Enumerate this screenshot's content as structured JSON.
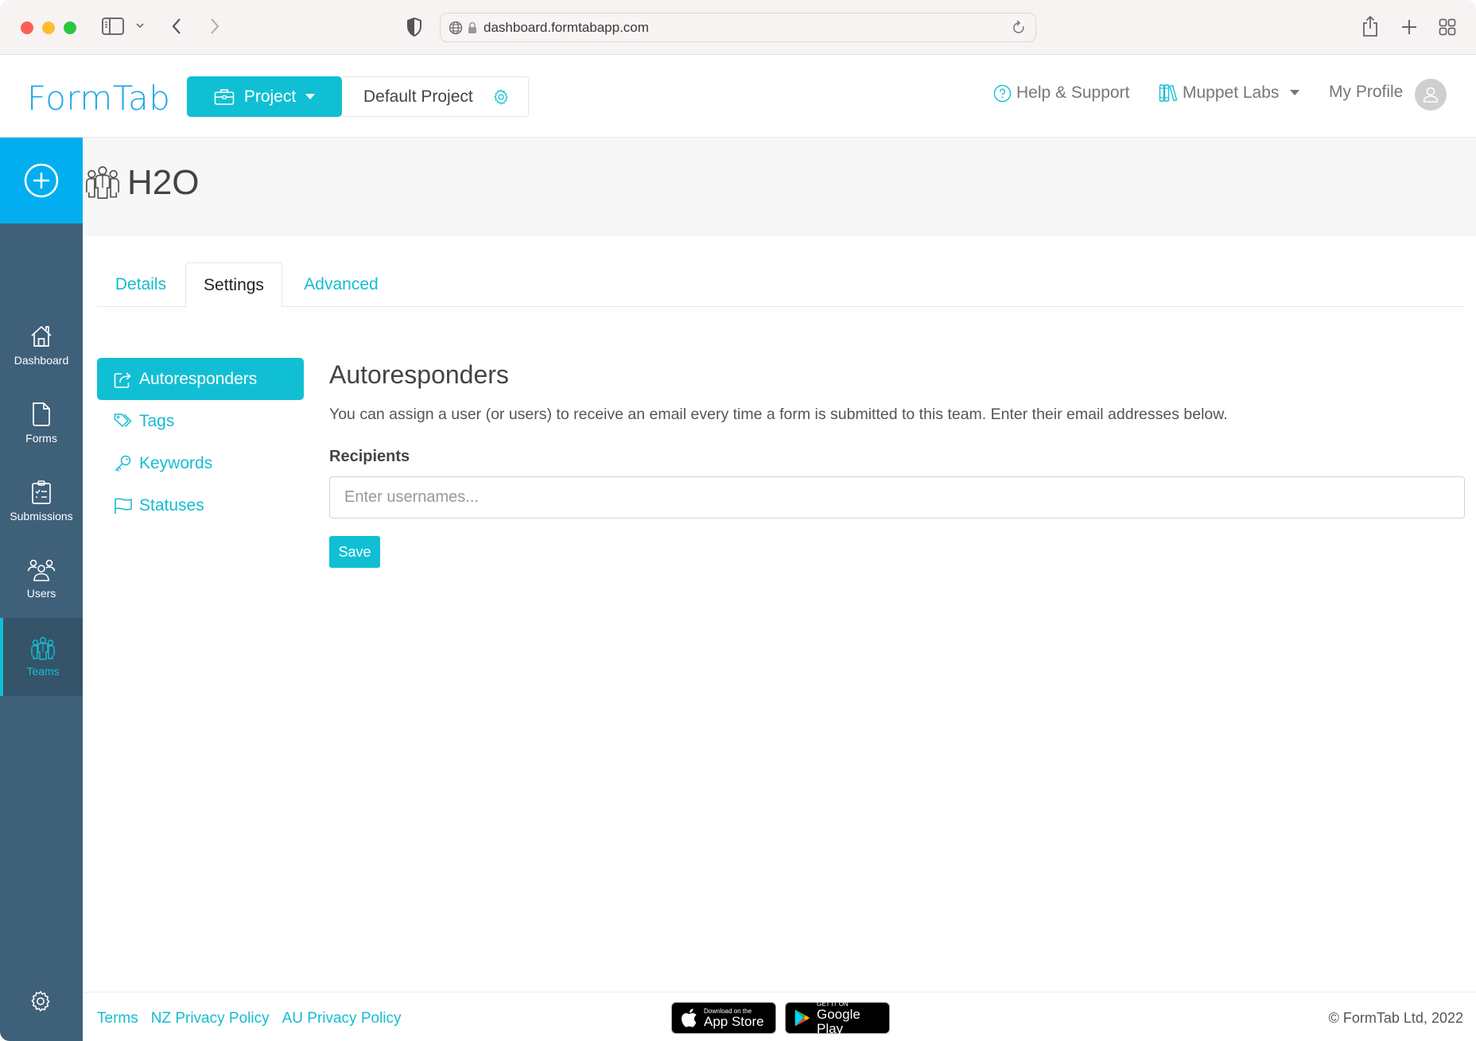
{
  "browser": {
    "url": "dashboard.formtabapp.com"
  },
  "header": {
    "logo": "FormTab",
    "project_button_label": "Project",
    "current_project": "Default Project",
    "help_label": "Help & Support",
    "org_label": "Muppet Labs",
    "profile_label": "My Profile"
  },
  "sidebar": {
    "items": [
      {
        "label": "Dashboard",
        "icon": "home-icon"
      },
      {
        "label": "Forms",
        "icon": "file-icon"
      },
      {
        "label": "Submissions",
        "icon": "clipboard-check-icon"
      },
      {
        "label": "Users",
        "icon": "users-icon"
      },
      {
        "label": "Teams",
        "icon": "team-icon",
        "active": true
      }
    ]
  },
  "page": {
    "title": "H2O"
  },
  "tabs": [
    {
      "label": "Details"
    },
    {
      "label": "Settings",
      "active": true
    },
    {
      "label": "Advanced"
    }
  ],
  "settings_nav": [
    {
      "label": "Autoresponders",
      "icon": "share-icon",
      "active": true
    },
    {
      "label": "Tags",
      "icon": "tags-icon"
    },
    {
      "label": "Keywords",
      "icon": "key-icon"
    },
    {
      "label": "Statuses",
      "icon": "flag-icon"
    }
  ],
  "content": {
    "heading": "Autoresponders",
    "description": "You can assign a user (or users) to receive an email every time a form is submitted to this team. Enter their email addresses below.",
    "recipients_label": "Recipients",
    "recipients_placeholder": "Enter usernames...",
    "recipients_value": "",
    "save_label": "Save"
  },
  "footer": {
    "links": [
      "Terms",
      "NZ Privacy Policy",
      "AU Privacy Policy"
    ],
    "app_store": {
      "small": "Download on the",
      "big": "App Store"
    },
    "google_play": {
      "small": "GET IT ON",
      "big": "Google Play"
    },
    "copyright": "© FormTab Ltd, 2022"
  },
  "colors": {
    "accent": "#11bfd4",
    "brand": "#1aa7ec",
    "sidebar": "#3f6079",
    "add_button": "#03aef0"
  }
}
